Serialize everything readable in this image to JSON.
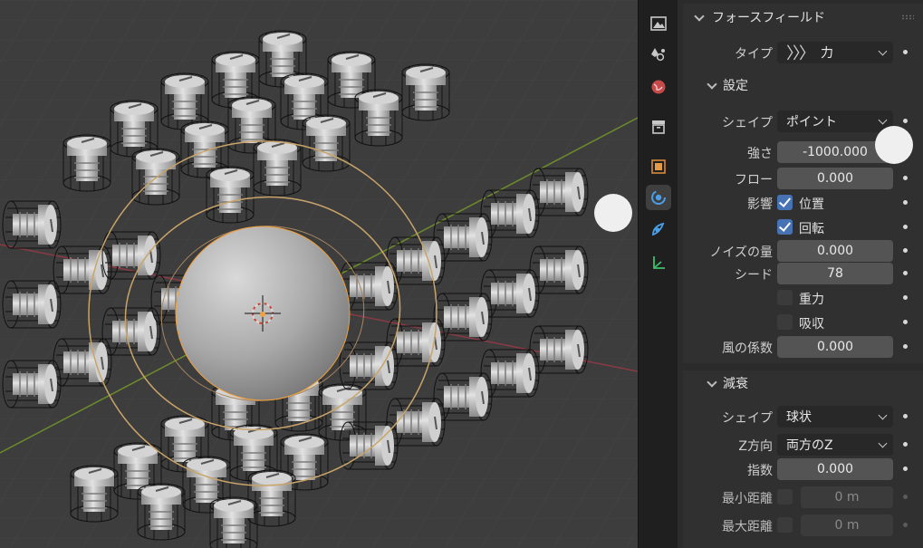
{
  "tabs": [
    {
      "name": "render-tab"
    },
    {
      "name": "scene-tab"
    },
    {
      "name": "world-tab"
    },
    {
      "name": "collection-tab"
    },
    {
      "name": "object-tab"
    },
    {
      "name": "physics-tab"
    },
    {
      "name": "particles-tab"
    },
    {
      "name": "constraints-tab"
    }
  ],
  "panel": {
    "title": "フォースフィールド",
    "type_label": "タイプ",
    "type_value": "力",
    "settings_title": "設定",
    "shape_label": "シェイプ",
    "shape_value": "ポイント",
    "strength_label": "強さ",
    "strength_value": "-1000.000",
    "flow_label": "フロー",
    "flow_value": "0.000",
    "affect_label": "影響",
    "affect_location": "位置",
    "affect_rotation": "回転",
    "noise_label": "ノイズの量",
    "noise_value": "0.000",
    "seed_label": "シード",
    "seed_value": "78",
    "gravity_label": "重力",
    "absorption_label": "吸収",
    "wind_label": "風の係数",
    "wind_value": "0.000",
    "falloff_title": "減衰",
    "falloff_shape_label": "シェイプ",
    "falloff_shape_value": "球状",
    "z_label": "Z方向",
    "z_value": "両方のZ",
    "power_label": "指数",
    "power_value": "0.000",
    "min_label": "最小距離",
    "min_value": "0 m",
    "max_label": "最大距離",
    "max_value": "0 m"
  },
  "colors": {
    "viewport_bg": "#3d3d3d",
    "accent": "#4772b3",
    "selection_orange": "#f0a03c"
  }
}
